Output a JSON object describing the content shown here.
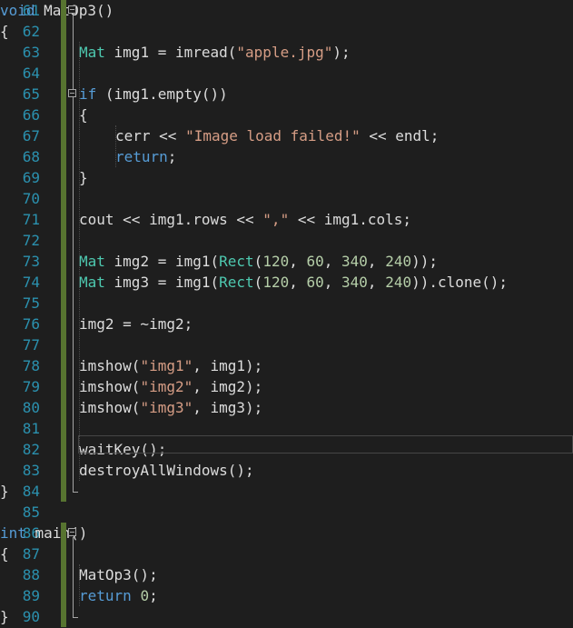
{
  "editor": {
    "line_numbers": [
      "61",
      "62",
      "63",
      "64",
      "65",
      "66",
      "67",
      "68",
      "69",
      "70",
      "71",
      "72",
      "73",
      "74",
      "75",
      "76",
      "77",
      "78",
      "79",
      "80",
      "81",
      "82",
      "83",
      "84",
      "85",
      "86",
      "87",
      "88",
      "89",
      "90"
    ],
    "colors": {
      "background": "#1e1e1e",
      "line_number": "#2b91af",
      "keyword": "#569cd6",
      "type": "#4ec9b0",
      "string": "#d69d85",
      "number": "#b5cea8",
      "text": "#dcdcdc",
      "change_bar": "#577430"
    },
    "lines": [
      [
        {
          "t": "void",
          "c": "kw"
        },
        {
          "t": " MatOp3()",
          "c": "tx"
        }
      ],
      [
        {
          "t": "{",
          "c": "tx"
        }
      ],
      [
        {
          "t": "Mat",
          "c": "ty"
        },
        {
          "t": " img1 = imread(",
          "c": "tx"
        },
        {
          "t": "\"apple.jpg\"",
          "c": "st"
        },
        {
          "t": ");",
          "c": "tx"
        }
      ],
      [],
      [
        {
          "t": "if",
          "c": "kw"
        },
        {
          "t": " (img1.empty())",
          "c": "tx"
        }
      ],
      [
        {
          "t": "{",
          "c": "tx"
        }
      ],
      [
        {
          "t": "cerr << ",
          "c": "tx"
        },
        {
          "t": "\"Image load failed!\"",
          "c": "st"
        },
        {
          "t": " << endl;",
          "c": "tx"
        }
      ],
      [
        {
          "t": "return",
          "c": "kw"
        },
        {
          "t": ";",
          "c": "tx"
        }
      ],
      [
        {
          "t": "}",
          "c": "tx"
        }
      ],
      [],
      [
        {
          "t": "cout << img1.rows << ",
          "c": "tx"
        },
        {
          "t": "\",\"",
          "c": "st"
        },
        {
          "t": " << img1.cols;",
          "c": "tx"
        }
      ],
      [],
      [
        {
          "t": "Mat",
          "c": "ty"
        },
        {
          "t": " img2 = img1(",
          "c": "tx"
        },
        {
          "t": "Rect",
          "c": "ty"
        },
        {
          "t": "(",
          "c": "tx"
        },
        {
          "t": "120",
          "c": "nu"
        },
        {
          "t": ", ",
          "c": "tx"
        },
        {
          "t": "60",
          "c": "nu"
        },
        {
          "t": ", ",
          "c": "tx"
        },
        {
          "t": "340",
          "c": "nu"
        },
        {
          "t": ", ",
          "c": "tx"
        },
        {
          "t": "240",
          "c": "nu"
        },
        {
          "t": "));",
          "c": "tx"
        }
      ],
      [
        {
          "t": "Mat",
          "c": "ty"
        },
        {
          "t": " img3 = img1(",
          "c": "tx"
        },
        {
          "t": "Rect",
          "c": "ty"
        },
        {
          "t": "(",
          "c": "tx"
        },
        {
          "t": "120",
          "c": "nu"
        },
        {
          "t": ", ",
          "c": "tx"
        },
        {
          "t": "60",
          "c": "nu"
        },
        {
          "t": ", ",
          "c": "tx"
        },
        {
          "t": "340",
          "c": "nu"
        },
        {
          "t": ", ",
          "c": "tx"
        },
        {
          "t": "240",
          "c": "nu"
        },
        {
          "t": ")).clone();",
          "c": "tx"
        }
      ],
      [],
      [
        {
          "t": "img2 = ~img2;",
          "c": "tx"
        }
      ],
      [],
      [
        {
          "t": "imshow(",
          "c": "tx"
        },
        {
          "t": "\"img1\"",
          "c": "st"
        },
        {
          "t": ", img1);",
          "c": "tx"
        }
      ],
      [
        {
          "t": "imshow(",
          "c": "tx"
        },
        {
          "t": "\"img2\"",
          "c": "st"
        },
        {
          "t": ", img2);",
          "c": "tx"
        }
      ],
      [
        {
          "t": "imshow(",
          "c": "tx"
        },
        {
          "t": "\"img3\"",
          "c": "st"
        },
        {
          "t": ", img3);",
          "c": "tx"
        }
      ],
      [],
      [
        {
          "t": "waitKey();",
          "c": "tx"
        }
      ],
      [
        {
          "t": "destroyAllWindows();",
          "c": "tx"
        }
      ],
      [
        {
          "t": "}",
          "c": "tx"
        }
      ],
      [],
      [
        {
          "t": "int",
          "c": "kw"
        },
        {
          "t": " main()",
          "c": "tx"
        }
      ],
      [
        {
          "t": "{",
          "c": "tx"
        }
      ],
      [
        {
          "t": "MatOp3();",
          "c": "tx"
        }
      ],
      [
        {
          "t": "return",
          "c": "kw"
        },
        {
          "t": " ",
          "c": "tx"
        },
        {
          "t": "0",
          "c": "nu"
        },
        {
          "t": ";",
          "c": "tx"
        }
      ],
      [
        {
          "t": "}",
          "c": "tx"
        }
      ]
    ]
  }
}
